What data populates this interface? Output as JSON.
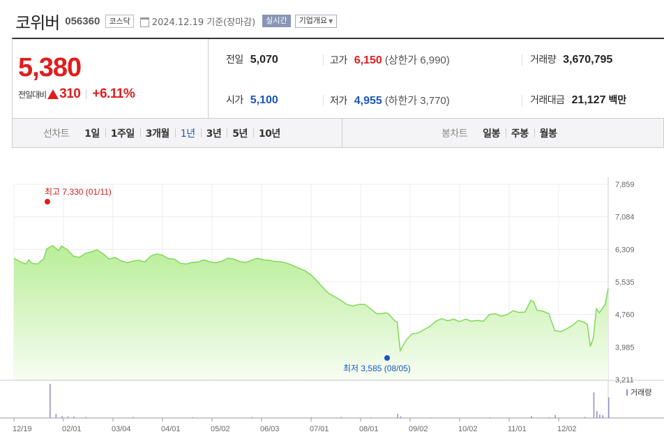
{
  "header": {
    "name": "코위버",
    "code": "056360",
    "market": "코스닥",
    "date": "2024.12.19",
    "date_suffix": "기준(장마감)",
    "realtime": "실시간",
    "company_info": "기업개요"
  },
  "summary": {
    "price": "5,380",
    "change_label": "전일대비",
    "change": "310",
    "change_pct": "+6.11%",
    "prev_label": "전일",
    "prev": "5,070",
    "high_label": "고가",
    "high": "6,150",
    "upper_limit_label": "(상한가",
    "upper_limit": "6,990)",
    "volume_label": "거래량",
    "volume": "3,670,795",
    "open_label": "시가",
    "open": "5,100",
    "low_label": "저가",
    "low": "4,955",
    "lower_limit_label": "(하한가",
    "lower_limit": "3,770)",
    "amount_label": "거래대금",
    "amount": "21,127",
    "amount_unit": "백만"
  },
  "periods": {
    "line_label": "선차트",
    "line_items": [
      "1일",
      "1주일",
      "3개월",
      "1년",
      "3년",
      "5년",
      "10년"
    ],
    "active": "1년",
    "candle_label": "봉차트",
    "candle_items": [
      "일봉",
      "주봉",
      "월봉"
    ]
  },
  "chart_data": {
    "type": "area",
    "title": "",
    "ylim": [
      3211,
      7859
    ],
    "yticks": [
      "7,859",
      "7,084",
      "6,309",
      "5,535",
      "4,760",
      "3,985",
      "3,211"
    ],
    "xticks": [
      "12/19",
      "02/01",
      "03/04",
      "04/01",
      "05/02",
      "06/03",
      "07/01",
      "08/01",
      "09/02",
      "10/02",
      "11/01",
      "12/02"
    ],
    "max_annotation": "최고 7,330 (01/11)",
    "min_annotation": "최저 3,585 (08/05)",
    "volume_legend": "거래량",
    "grid": true,
    "line_color": "#7ed957",
    "fill_top": "#b9ee98",
    "fill_bottom": "#f7fdf3",
    "volume_color": "#8c8cc8",
    "price_points": [
      [
        0,
        6100
      ],
      [
        0.01,
        6020
      ],
      [
        0.02,
        5960
      ],
      [
        0.025,
        6060
      ],
      [
        0.03,
        5980
      ],
      [
        0.04,
        5960
      ],
      [
        0.045,
        6030
      ],
      [
        0.05,
        6080
      ],
      [
        0.055,
        6320
      ],
      [
        0.065,
        6400
      ],
      [
        0.075,
        6280
      ],
      [
        0.08,
        6390
      ],
      [
        0.09,
        6300
      ],
      [
        0.1,
        6150
      ],
      [
        0.11,
        6120
      ],
      [
        0.12,
        6210
      ],
      [
        0.13,
        6250
      ],
      [
        0.14,
        6300
      ],
      [
        0.15,
        6200
      ],
      [
        0.16,
        6080
      ],
      [
        0.17,
        6120
      ],
      [
        0.18,
        6040
      ],
      [
        0.19,
        5990
      ],
      [
        0.2,
        6030
      ],
      [
        0.21,
        6050
      ],
      [
        0.22,
        6010
      ],
      [
        0.23,
        6150
      ],
      [
        0.24,
        6200
      ],
      [
        0.25,
        6170
      ],
      [
        0.26,
        6090
      ],
      [
        0.27,
        6080
      ],
      [
        0.28,
        5980
      ],
      [
        0.29,
        5960
      ],
      [
        0.3,
        6000
      ],
      [
        0.31,
        6010
      ],
      [
        0.32,
        6060
      ],
      [
        0.33,
        6010
      ],
      [
        0.34,
        5990
      ],
      [
        0.35,
        6030
      ],
      [
        0.36,
        6100
      ],
      [
        0.37,
        6080
      ],
      [
        0.38,
        6020
      ],
      [
        0.39,
        6000
      ],
      [
        0.4,
        6050
      ],
      [
        0.41,
        6100
      ],
      [
        0.42,
        6060
      ],
      [
        0.43,
        6050
      ],
      [
        0.44,
        6020
      ],
      [
        0.45,
        6010
      ],
      [
        0.46,
        5980
      ],
      [
        0.47,
        5920
      ],
      [
        0.48,
        5860
      ],
      [
        0.49,
        5800
      ],
      [
        0.5,
        5700
      ],
      [
        0.51,
        5560
      ],
      [
        0.52,
        5400
      ],
      [
        0.53,
        5260
      ],
      [
        0.54,
        5180
      ],
      [
        0.55,
        5100
      ],
      [
        0.56,
        5000
      ],
      [
        0.57,
        4960
      ],
      [
        0.58,
        5000
      ],
      [
        0.59,
        5000
      ],
      [
        0.6,
        4900
      ],
      [
        0.61,
        4780
      ],
      [
        0.62,
        4780
      ],
      [
        0.625,
        4800
      ],
      [
        0.63,
        4780
      ],
      [
        0.64,
        4620
      ],
      [
        0.645,
        4580
      ],
      [
        0.65,
        3900
      ],
      [
        0.66,
        4150
      ],
      [
        0.67,
        4300
      ],
      [
        0.68,
        4320
      ],
      [
        0.69,
        4400
      ],
      [
        0.7,
        4480
      ],
      [
        0.71,
        4600
      ],
      [
        0.72,
        4660
      ],
      [
        0.73,
        4610
      ],
      [
        0.74,
        4650
      ],
      [
        0.75,
        4590
      ],
      [
        0.76,
        4650
      ],
      [
        0.77,
        4600
      ],
      [
        0.78,
        4620
      ],
      [
        0.79,
        4600
      ],
      [
        0.8,
        4760
      ],
      [
        0.81,
        4780
      ],
      [
        0.82,
        4720
      ],
      [
        0.83,
        4760
      ],
      [
        0.84,
        4850
      ],
      [
        0.85,
        4810
      ],
      [
        0.86,
        4820
      ],
      [
        0.87,
        5100
      ],
      [
        0.875,
        5050
      ],
      [
        0.88,
        4860
      ],
      [
        0.89,
        4840
      ],
      [
        0.9,
        4780
      ],
      [
        0.91,
        4380
      ],
      [
        0.92,
        4350
      ],
      [
        0.93,
        4420
      ],
      [
        0.94,
        4500
      ],
      [
        0.95,
        4620
      ],
      [
        0.96,
        4570
      ],
      [
        0.965,
        4520
      ],
      [
        0.97,
        4000
      ],
      [
        0.975,
        4200
      ],
      [
        0.98,
        4900
      ],
      [
        0.985,
        4800
      ],
      [
        0.99,
        4900
      ],
      [
        0.995,
        5000
      ],
      [
        1,
        5380
      ]
    ],
    "volume_points": [
      [
        0.06,
        1.0
      ],
      [
        0.07,
        0.12
      ],
      [
        0.08,
        0.06
      ],
      [
        0.09,
        0.05
      ],
      [
        0.1,
        0.04
      ],
      [
        0.12,
        0.03
      ],
      [
        0.2,
        0.03
      ],
      [
        0.3,
        0.02
      ],
      [
        0.4,
        0.03
      ],
      [
        0.5,
        0.02
      ],
      [
        0.55,
        0.03
      ],
      [
        0.6,
        0.02
      ],
      [
        0.645,
        0.12
      ],
      [
        0.65,
        0.05
      ],
      [
        0.7,
        0.02
      ],
      [
        0.8,
        0.02
      ],
      [
        0.87,
        0.06
      ],
      [
        0.9,
        0.02
      ],
      [
        0.91,
        0.09
      ],
      [
        0.96,
        0.03
      ],
      [
        0.975,
        0.75
      ],
      [
        0.98,
        0.2
      ],
      [
        0.985,
        0.1
      ],
      [
        0.99,
        0.08
      ],
      [
        1,
        0.6
      ]
    ]
  }
}
